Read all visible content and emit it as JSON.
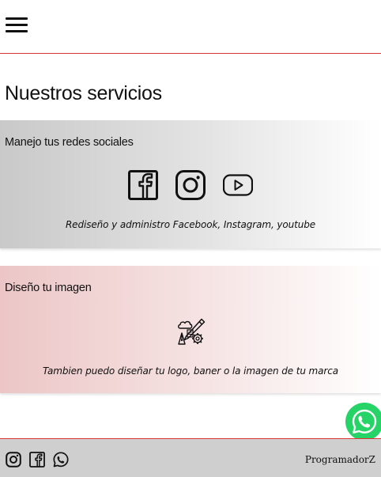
{
  "header": {
    "menu_icon": "hamburger-menu-icon"
  },
  "main": {
    "title": "Nuestros servicios",
    "services": [
      {
        "title": "Manejo tus redes sociales",
        "icons": [
          "facebook-icon",
          "instagram-icon",
          "youtube-icon"
        ],
        "description": "Rediseño y administro Facebook, Instagram, youtube",
        "background_start": "#c9c9c9"
      },
      {
        "title": "Diseño tu imagen",
        "icons": [
          "design-tools-icon"
        ],
        "description": "Tambien puedo diseñar tu logo, baner o la imagen de tu marca",
        "background_start": "#ecc6c6"
      }
    ]
  },
  "floating": {
    "icon": "whatsapp-icon",
    "color": "#25d366"
  },
  "footer": {
    "icons": [
      "instagram-icon",
      "facebook-icon",
      "whatsapp-icon"
    ],
    "brand": "ProgramadorZ",
    "background": "#cfcfcf",
    "border_color": "#dd3333"
  }
}
